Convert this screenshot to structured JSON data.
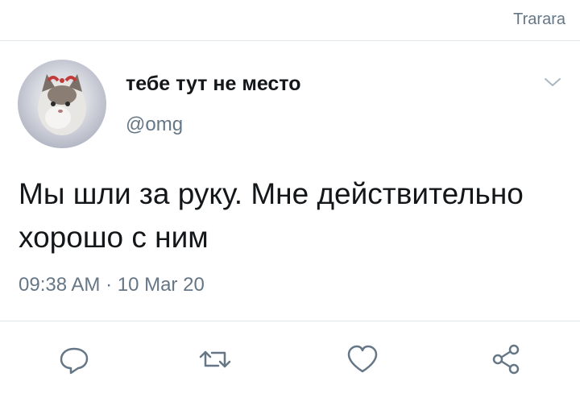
{
  "header": {
    "app_title": "Trarara"
  },
  "tweet": {
    "display_name": "тебе тут не место",
    "handle": "@omg",
    "text": "Мы шли за руку. Мне действительно хорошо с ним",
    "timestamp": "09:38 AM · 10 Mar 20"
  },
  "actions": [
    {
      "icon": "reply-icon"
    },
    {
      "icon": "retweet-icon"
    },
    {
      "icon": "like-icon"
    },
    {
      "icon": "share-icon"
    }
  ],
  "colors": {
    "secondary_text": "#657786",
    "divider": "#e1e8ed",
    "primary_text": "#14171a"
  }
}
